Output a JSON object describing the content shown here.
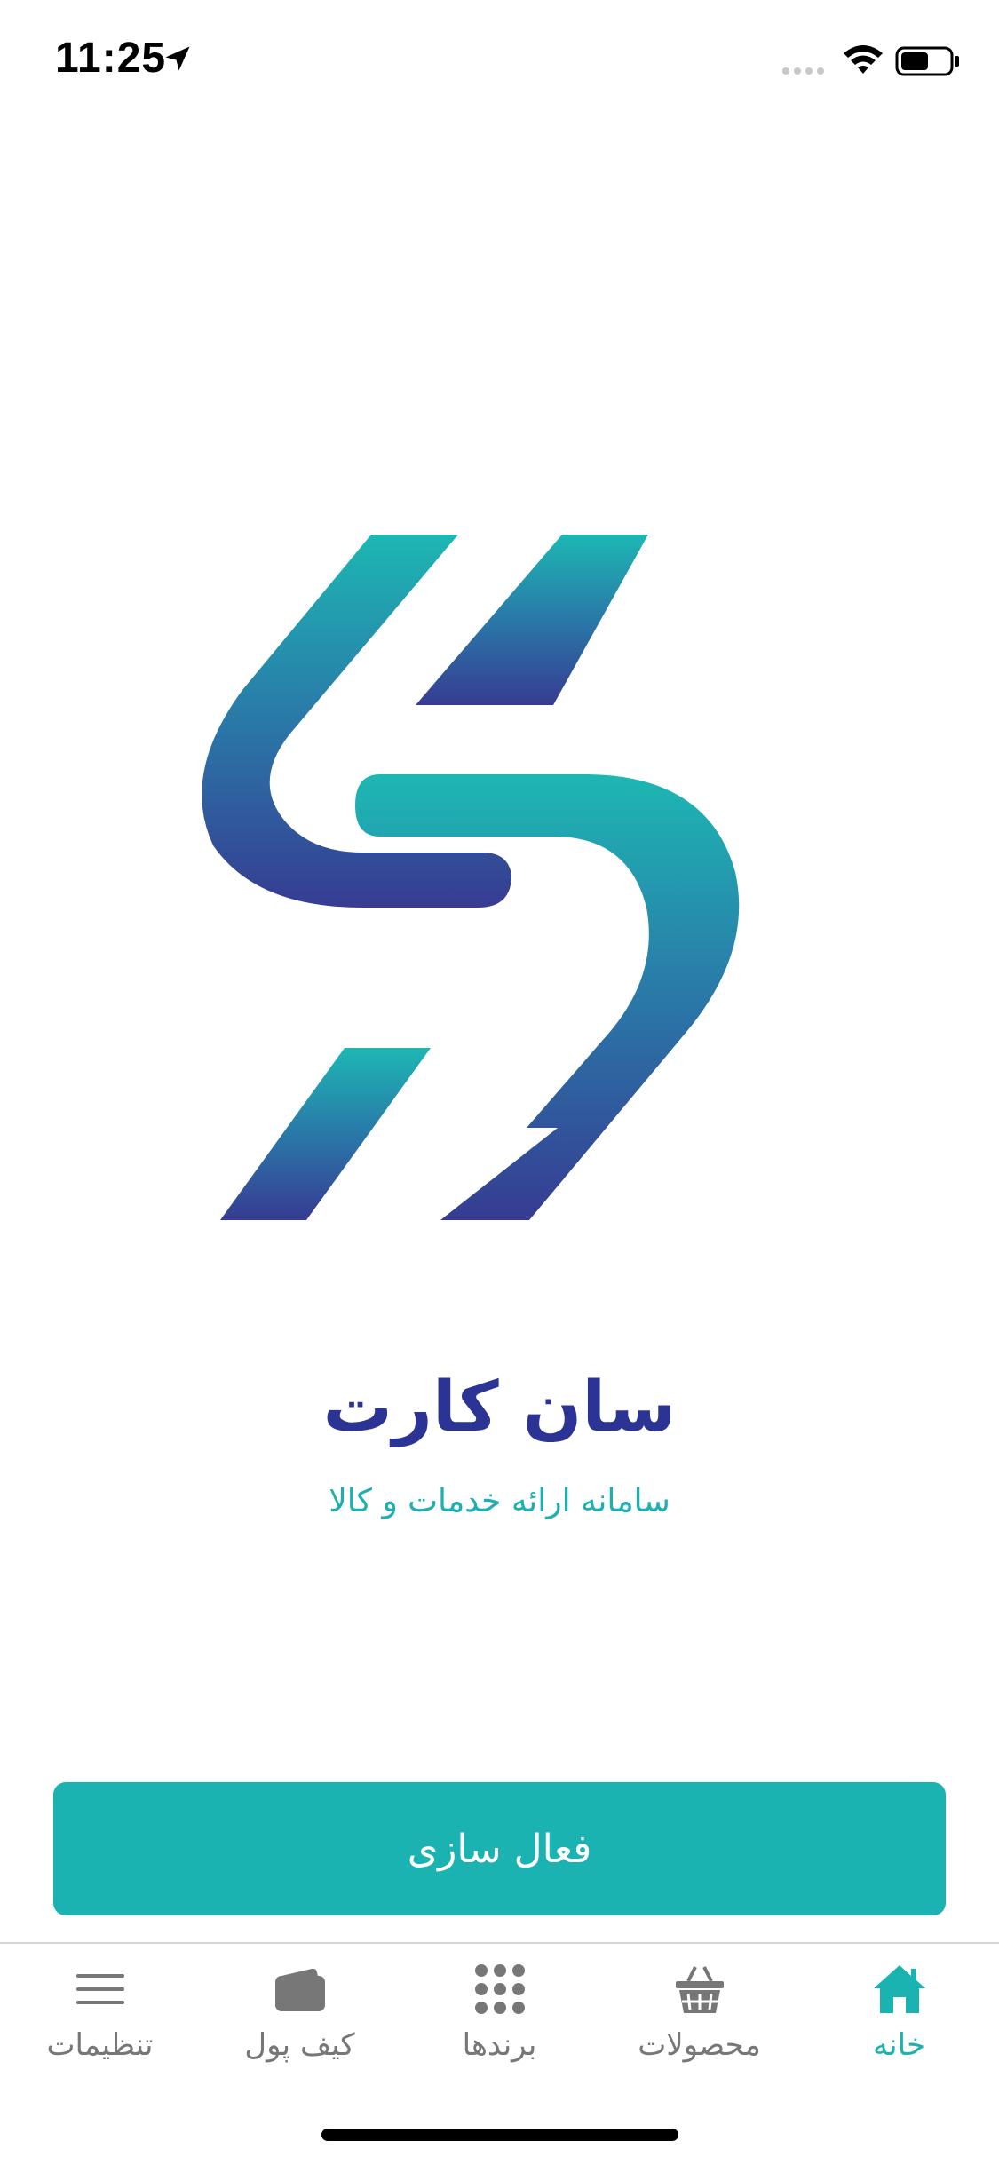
{
  "status_bar": {
    "time": "11:25"
  },
  "brand": {
    "title": "سان کارت",
    "subtitle": "سامانه ارائه خدمات و کالا"
  },
  "activate_button": {
    "label": "فعال سازی"
  },
  "tab_bar": {
    "tabs": [
      {
        "label": "خانه",
        "icon": "home-icon",
        "active": true
      },
      {
        "label": "محصولات",
        "icon": "basket-icon",
        "active": false
      },
      {
        "label": "برندها",
        "icon": "grid-dots-icon",
        "active": false
      },
      {
        "label": "کیف پول",
        "icon": "wallet-icon",
        "active": false
      },
      {
        "label": "تنظیمات",
        "icon": "menu-icon",
        "active": false
      }
    ]
  },
  "colors": {
    "accent": "#1BB2B2",
    "brand_dark": "#2B3494",
    "tab_inactive": "#777777"
  }
}
